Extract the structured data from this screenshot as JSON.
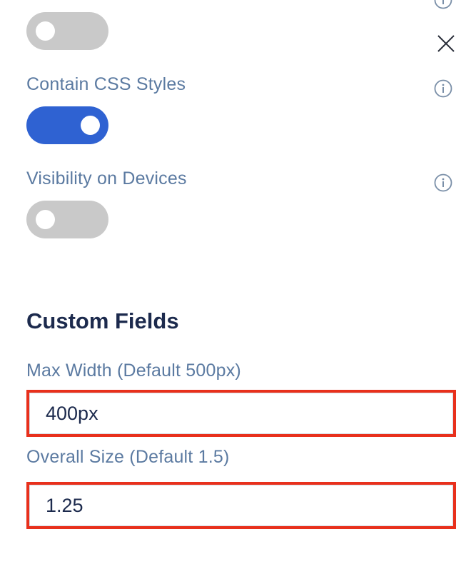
{
  "settings": {
    "top_toggle": {
      "state": "off"
    },
    "contain_css": {
      "label": "Contain CSS Styles",
      "state": "on"
    },
    "visibility": {
      "label": "Visibility on Devices",
      "state": "off"
    }
  },
  "custom_fields": {
    "title": "Custom Fields",
    "max_width": {
      "label": "Max Width (Default 500px)",
      "value": "400px"
    },
    "overall_size": {
      "label": "Overall Size (Default 1.5)",
      "value": "1.25"
    }
  },
  "colors": {
    "toggle_on": "#2f62d2",
    "toggle_off": "#c9c9c9",
    "label": "#5b7aa1",
    "heading": "#1c2a4d",
    "highlight": "#e8301c"
  },
  "icons": {
    "info": "info-icon",
    "close": "close-icon"
  }
}
